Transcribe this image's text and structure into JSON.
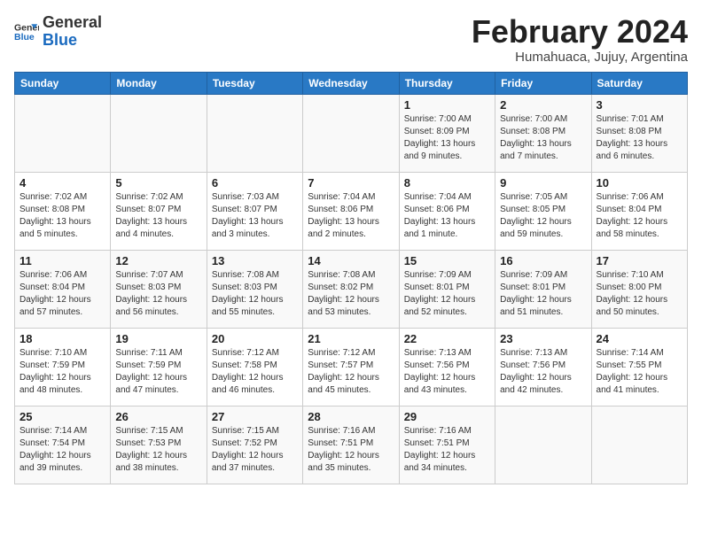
{
  "logo": {
    "line1": "General",
    "line2": "Blue"
  },
  "title": "February 2024",
  "subtitle": "Humahuaca, Jujuy, Argentina",
  "headers": [
    "Sunday",
    "Monday",
    "Tuesday",
    "Wednesday",
    "Thursday",
    "Friday",
    "Saturday"
  ],
  "weeks": [
    [
      {
        "day": "",
        "info": ""
      },
      {
        "day": "",
        "info": ""
      },
      {
        "day": "",
        "info": ""
      },
      {
        "day": "",
        "info": ""
      },
      {
        "day": "1",
        "info": "Sunrise: 7:00 AM\nSunset: 8:09 PM\nDaylight: 13 hours\nand 9 minutes."
      },
      {
        "day": "2",
        "info": "Sunrise: 7:00 AM\nSunset: 8:08 PM\nDaylight: 13 hours\nand 7 minutes."
      },
      {
        "day": "3",
        "info": "Sunrise: 7:01 AM\nSunset: 8:08 PM\nDaylight: 13 hours\nand 6 minutes."
      }
    ],
    [
      {
        "day": "4",
        "info": "Sunrise: 7:02 AM\nSunset: 8:08 PM\nDaylight: 13 hours\nand 5 minutes."
      },
      {
        "day": "5",
        "info": "Sunrise: 7:02 AM\nSunset: 8:07 PM\nDaylight: 13 hours\nand 4 minutes."
      },
      {
        "day": "6",
        "info": "Sunrise: 7:03 AM\nSunset: 8:07 PM\nDaylight: 13 hours\nand 3 minutes."
      },
      {
        "day": "7",
        "info": "Sunrise: 7:04 AM\nSunset: 8:06 PM\nDaylight: 13 hours\nand 2 minutes."
      },
      {
        "day": "8",
        "info": "Sunrise: 7:04 AM\nSunset: 8:06 PM\nDaylight: 13 hours\nand 1 minute."
      },
      {
        "day": "9",
        "info": "Sunrise: 7:05 AM\nSunset: 8:05 PM\nDaylight: 12 hours\nand 59 minutes."
      },
      {
        "day": "10",
        "info": "Sunrise: 7:06 AM\nSunset: 8:04 PM\nDaylight: 12 hours\nand 58 minutes."
      }
    ],
    [
      {
        "day": "11",
        "info": "Sunrise: 7:06 AM\nSunset: 8:04 PM\nDaylight: 12 hours\nand 57 minutes."
      },
      {
        "day": "12",
        "info": "Sunrise: 7:07 AM\nSunset: 8:03 PM\nDaylight: 12 hours\nand 56 minutes."
      },
      {
        "day": "13",
        "info": "Sunrise: 7:08 AM\nSunset: 8:03 PM\nDaylight: 12 hours\nand 55 minutes."
      },
      {
        "day": "14",
        "info": "Sunrise: 7:08 AM\nSunset: 8:02 PM\nDaylight: 12 hours\nand 53 minutes."
      },
      {
        "day": "15",
        "info": "Sunrise: 7:09 AM\nSunset: 8:01 PM\nDaylight: 12 hours\nand 52 minutes."
      },
      {
        "day": "16",
        "info": "Sunrise: 7:09 AM\nSunset: 8:01 PM\nDaylight: 12 hours\nand 51 minutes."
      },
      {
        "day": "17",
        "info": "Sunrise: 7:10 AM\nSunset: 8:00 PM\nDaylight: 12 hours\nand 50 minutes."
      }
    ],
    [
      {
        "day": "18",
        "info": "Sunrise: 7:10 AM\nSunset: 7:59 PM\nDaylight: 12 hours\nand 48 minutes."
      },
      {
        "day": "19",
        "info": "Sunrise: 7:11 AM\nSunset: 7:59 PM\nDaylight: 12 hours\nand 47 minutes."
      },
      {
        "day": "20",
        "info": "Sunrise: 7:12 AM\nSunset: 7:58 PM\nDaylight: 12 hours\nand 46 minutes."
      },
      {
        "day": "21",
        "info": "Sunrise: 7:12 AM\nSunset: 7:57 PM\nDaylight: 12 hours\nand 45 minutes."
      },
      {
        "day": "22",
        "info": "Sunrise: 7:13 AM\nSunset: 7:56 PM\nDaylight: 12 hours\nand 43 minutes."
      },
      {
        "day": "23",
        "info": "Sunrise: 7:13 AM\nSunset: 7:56 PM\nDaylight: 12 hours\nand 42 minutes."
      },
      {
        "day": "24",
        "info": "Sunrise: 7:14 AM\nSunset: 7:55 PM\nDaylight: 12 hours\nand 41 minutes."
      }
    ],
    [
      {
        "day": "25",
        "info": "Sunrise: 7:14 AM\nSunset: 7:54 PM\nDaylight: 12 hours\nand 39 minutes."
      },
      {
        "day": "26",
        "info": "Sunrise: 7:15 AM\nSunset: 7:53 PM\nDaylight: 12 hours\nand 38 minutes."
      },
      {
        "day": "27",
        "info": "Sunrise: 7:15 AM\nSunset: 7:52 PM\nDaylight: 12 hours\nand 37 minutes."
      },
      {
        "day": "28",
        "info": "Sunrise: 7:16 AM\nSunset: 7:51 PM\nDaylight: 12 hours\nand 35 minutes."
      },
      {
        "day": "29",
        "info": "Sunrise: 7:16 AM\nSunset: 7:51 PM\nDaylight: 12 hours\nand 34 minutes."
      },
      {
        "day": "",
        "info": ""
      },
      {
        "day": "",
        "info": ""
      }
    ]
  ]
}
